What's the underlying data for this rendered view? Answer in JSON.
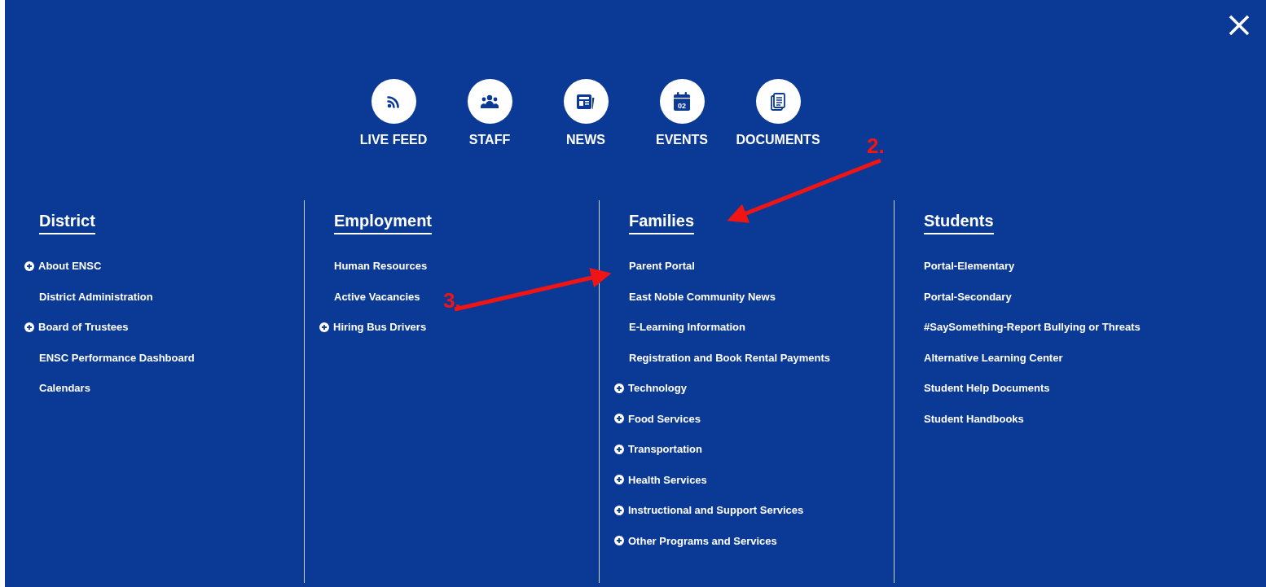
{
  "quick_links": [
    {
      "label": "LIVE FEED",
      "kind": "feed"
    },
    {
      "label": "STAFF",
      "kind": "staff"
    },
    {
      "label": "NEWS",
      "kind": "news"
    },
    {
      "label": "EVENTS",
      "kind": "events",
      "badge": "02"
    },
    {
      "label": "DOCUMENTS",
      "kind": "documents"
    }
  ],
  "columns": [
    {
      "heading": "District",
      "items": [
        {
          "label": "About ENSC",
          "kind": "submenu"
        },
        {
          "label": "District Administration",
          "kind": "link"
        },
        {
          "label": "Board of Trustees",
          "kind": "submenu"
        },
        {
          "label": "ENSC Performance Dashboard",
          "kind": "link"
        },
        {
          "label": "Calendars",
          "kind": "link"
        }
      ]
    },
    {
      "heading": "Employment",
      "items": [
        {
          "label": "Human Resources",
          "kind": "link"
        },
        {
          "label": "Active Vacancies",
          "kind": "link"
        },
        {
          "label": "Hiring Bus Drivers",
          "kind": "submenu"
        }
      ]
    },
    {
      "heading": "Families",
      "items": [
        {
          "label": "Parent Portal",
          "kind": "link"
        },
        {
          "label": "East Noble Community News",
          "kind": "link"
        },
        {
          "label": "E-Learning Information",
          "kind": "link"
        },
        {
          "label": "Registration and Book Rental Payments",
          "kind": "link"
        },
        {
          "label": "Technology",
          "kind": "submenu"
        },
        {
          "label": "Food Services",
          "kind": "submenu"
        },
        {
          "label": "Transportation",
          "kind": "submenu"
        },
        {
          "label": "Health Services",
          "kind": "submenu"
        },
        {
          "label": "Instructional and Support Services",
          "kind": "submenu"
        },
        {
          "label": "Other Programs and Services",
          "kind": "submenu"
        }
      ]
    },
    {
      "heading": "Students",
      "items": [
        {
          "label": "Portal-Elementary",
          "kind": "link"
        },
        {
          "label": "Portal-Secondary",
          "kind": "link"
        },
        {
          "label": "#SaySomething-Report Bullying or Threats",
          "kind": "link"
        },
        {
          "label": "Alternative Learning Center",
          "kind": "link"
        },
        {
          "label": "Student Help Documents",
          "kind": "link"
        },
        {
          "label": "Student Handbooks",
          "kind": "link"
        }
      ]
    }
  ],
  "annotations": [
    {
      "label": "2."
    },
    {
      "label": "3."
    }
  ]
}
